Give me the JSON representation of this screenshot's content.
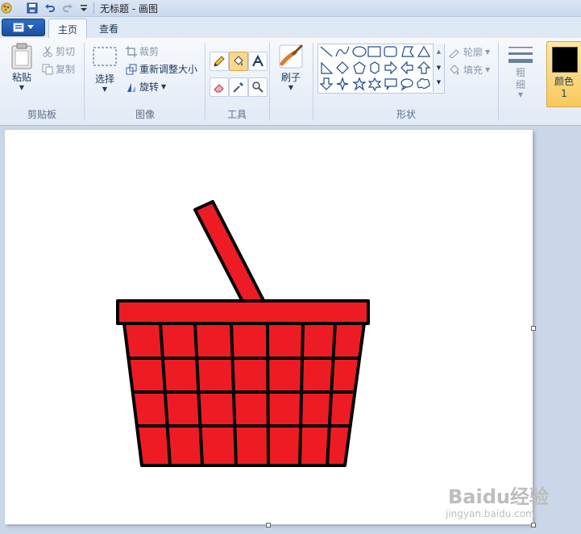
{
  "window": {
    "title": "无标题 - 画图"
  },
  "tabs": [
    {
      "label": "主页"
    },
    {
      "label": "查看"
    }
  ],
  "clipboard": {
    "paste_label": "粘贴",
    "cut_label": "剪切",
    "copy_label": "复制",
    "group_label": "剪贴板"
  },
  "image": {
    "select_label": "选择",
    "crop_label": "裁剪",
    "resize_label": "重新调整大小",
    "rotate_label": "旋转",
    "group_label": "图像"
  },
  "tools": {
    "group_label": "工具"
  },
  "brushes": {
    "label": "刷子"
  },
  "shapes": {
    "outline_label": "轮廓",
    "fill_label": "填充",
    "group_label": "形状"
  },
  "size": {
    "label": "粗细"
  },
  "colors": {
    "color1_label": "颜色 1",
    "color1_value": "#000000",
    "basket_color": "#ed1c24"
  },
  "watermark": {
    "brand": "Baidu经验",
    "url": "jingyan.baidu.com"
  }
}
